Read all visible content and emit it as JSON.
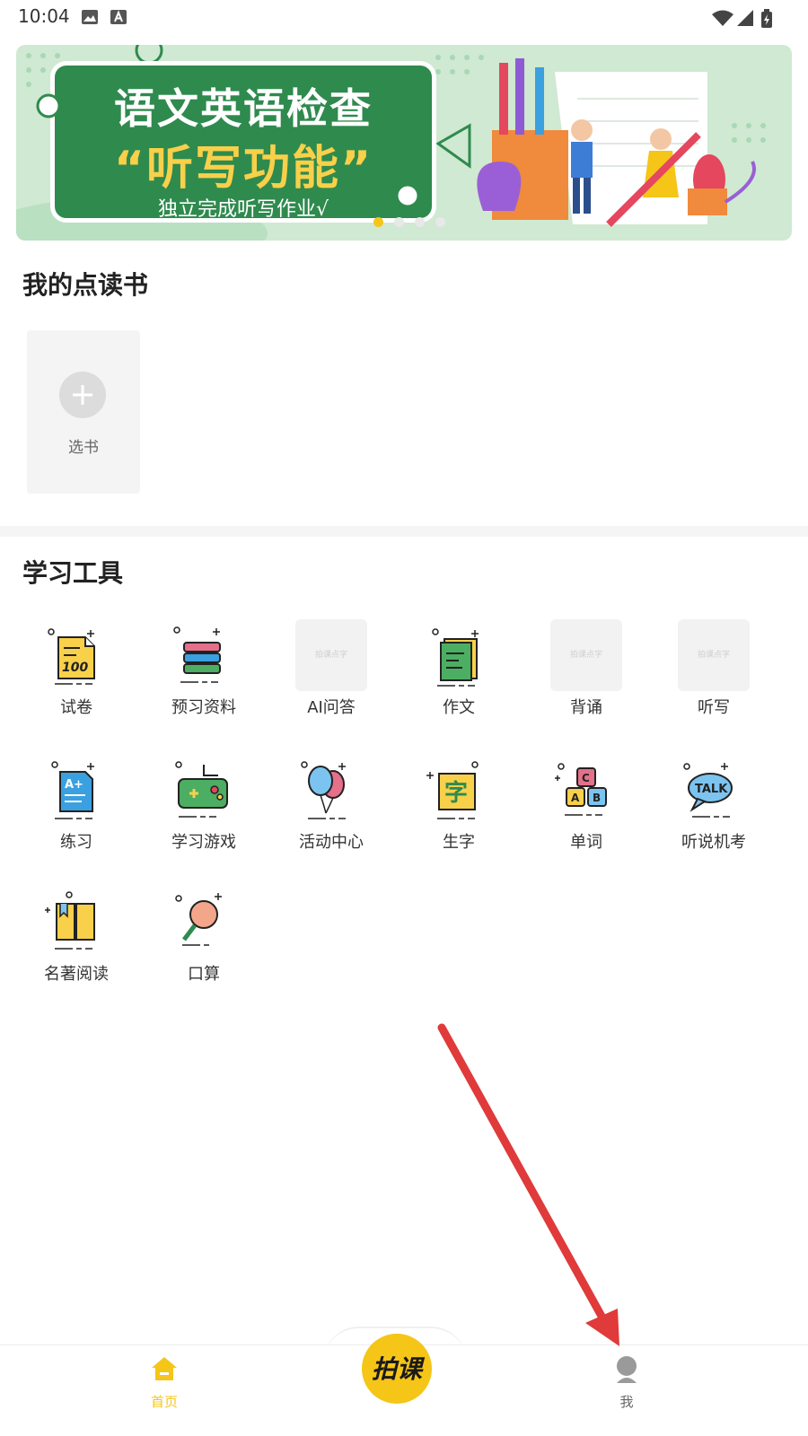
{
  "status": {
    "time": "10:04"
  },
  "banner": {
    "line1": "语文英语检查",
    "line2": "“听写功能”",
    "line3": "独立完成听写作业√",
    "slides": 4,
    "active_slide": 1
  },
  "sections": {
    "my_books": "我的点读书",
    "tools": "学习工具"
  },
  "add_book": {
    "label": "选书"
  },
  "tools": [
    {
      "label": "试卷",
      "icon": "exam-paper-icon"
    },
    {
      "label": "预习资料",
      "icon": "books-stack-icon"
    },
    {
      "label": "AI问答",
      "icon": "placeholder",
      "watermark": "拍课点字"
    },
    {
      "label": "作文",
      "icon": "essay-document-icon"
    },
    {
      "label": "背诵",
      "icon": "placeholder",
      "watermark": "拍课点字"
    },
    {
      "label": "听写",
      "icon": "placeholder",
      "watermark": "拍课点字"
    },
    {
      "label": "练习",
      "icon": "practice-sheet-icon"
    },
    {
      "label": "学习游戏",
      "icon": "gamepad-icon"
    },
    {
      "label": "活动中心",
      "icon": "balloons-icon"
    },
    {
      "label": "生字",
      "icon": "character-card-icon"
    },
    {
      "label": "单词",
      "icon": "letter-blocks-icon"
    },
    {
      "label": "听说机考",
      "icon": "talk-bubble-icon"
    },
    {
      "label": "名著阅读",
      "icon": "open-book-icon"
    },
    {
      "label": "口算",
      "icon": "magnifier-icon"
    }
  ],
  "nav": {
    "home": "首页",
    "center": "拍课",
    "me": "我"
  },
  "colors": {
    "accent": "#f5c518",
    "banner_board": "#2f8a4e",
    "annotation_arrow": "#e03a3a"
  }
}
